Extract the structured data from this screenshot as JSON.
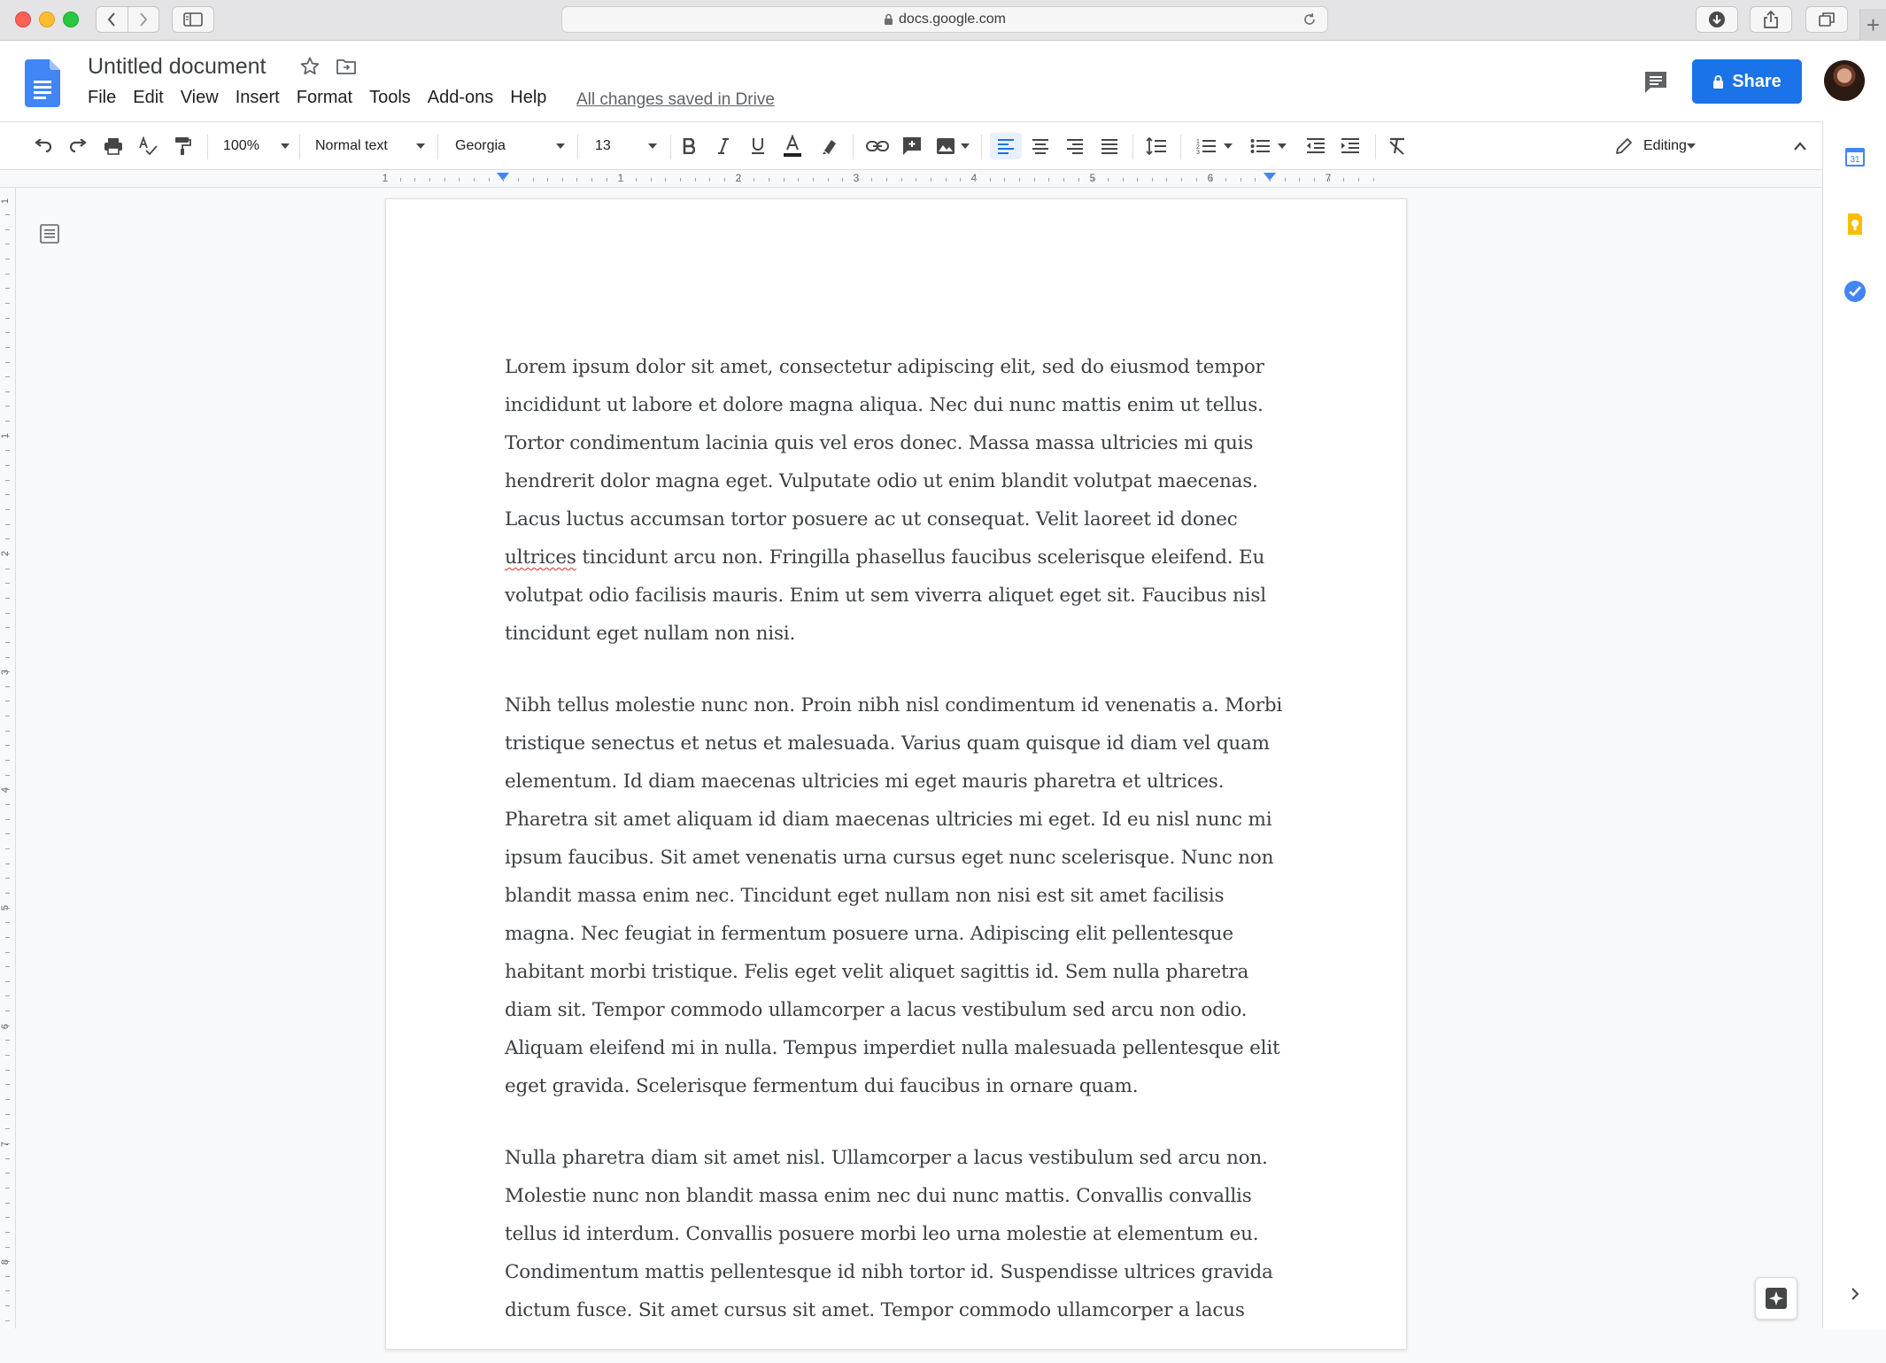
{
  "browser": {
    "url": "docs.google.com"
  },
  "header": {
    "title": "Untitled document",
    "menu": [
      "File",
      "Edit",
      "View",
      "Insert",
      "Format",
      "Tools",
      "Add-ons",
      "Help"
    ],
    "saved_status": "All changes saved in Drive",
    "share_label": "Share"
  },
  "toolbar": {
    "zoom": "100%",
    "style": "Normal text",
    "font": "Georgia",
    "font_size": "13",
    "mode": "Editing"
  },
  "ruler": {
    "labels": [
      "1",
      "1",
      "2",
      "3",
      "4",
      "5",
      "6",
      "7"
    ]
  },
  "v_ruler": {
    "labels": [
      "1",
      "1",
      "2",
      "3",
      "4",
      "5",
      "6",
      "7",
      "8"
    ]
  },
  "document": {
    "p1_before": "Lorem ipsum dolor sit amet, consectetur adipiscing elit, sed do eiusmod tempor incididunt ut labore et dolore magna aliqua. Nec dui nunc mattis enim ut tellus. Tortor condimentum lacinia quis vel eros donec. Massa massa ultricies mi quis hendrerit dolor magna eget. Vulputate odio ut enim blandit volutpat maecenas. Lacus luctus accumsan tortor posuere ac ut consequat. Velit laoreet id donec ",
    "p1_misspelled": "ultrices",
    "p1_after": " tincidunt arcu non. Fringilla phasellus faucibus scelerisque eleifend. Eu volutpat odio facilisis mauris. Enim ut sem viverra aliquet eget sit. Faucibus nisl tincidunt eget nullam non nisi.",
    "p2": "Nibh tellus molestie nunc non. Proin nibh nisl condimentum id venenatis a. Morbi tristique senectus et netus et malesuada. Varius quam quisque id diam vel quam elementum. Id diam maecenas ultricies mi eget mauris pharetra et ultrices. Pharetra sit amet aliquam id diam maecenas ultricies mi eget. Id eu nisl nunc mi ipsum faucibus. Sit amet venenatis urna cursus eget nunc scelerisque. Nunc non blandit massa enim nec. Tincidunt eget nullam non nisi est sit amet facilisis magna. Nec feugiat in fermentum posuere urna. Adipiscing elit pellentesque habitant morbi tristique. Felis eget velit aliquet sagittis id. Sem nulla pharetra diam sit. Tempor commodo ullamcorper a lacus vestibulum sed arcu non odio. Aliquam eleifend mi in nulla. Tempus imperdiet nulla malesuada pellentesque elit eget gravida. Scelerisque fermentum dui faucibus in ornare quam.",
    "p3": "Nulla pharetra diam sit amet nisl. Ullamcorper a lacus vestibulum sed arcu non. Molestie nunc non blandit massa enim nec dui nunc mattis. Convallis convallis tellus id interdum. Convallis posuere morbi leo urna molestie at elementum eu. Condimentum mattis pellentesque id nibh tortor id. Suspendisse ultrices gravida dictum fusce. Sit amet cursus sit amet. Tempor commodo ullamcorper a lacus"
  },
  "side_panel": {
    "calendar_day": "31"
  },
  "icons": {
    "browser": [
      "back-icon",
      "forward-icon",
      "sidebar-icon",
      "lock-icon",
      "reload-icon",
      "download-icon",
      "share-icon",
      "tabs-icon",
      "new-tab-icon"
    ],
    "header": [
      "docs-logo-icon",
      "star-icon",
      "move-folder-icon",
      "comment-icon",
      "lock-icon"
    ],
    "toolbar": [
      "undo-icon",
      "redo-icon",
      "print-icon",
      "spellcheck-icon",
      "paint-format-icon",
      "bold-icon",
      "italic-icon",
      "underline-icon",
      "text-color-icon",
      "highlight-icon",
      "link-icon",
      "add-comment-icon",
      "image-icon",
      "align-left-icon",
      "align-center-icon",
      "align-right-icon",
      "justify-icon",
      "line-spacing-icon",
      "numbered-list-icon",
      "bulleted-list-icon",
      "decrease-indent-icon",
      "increase-indent-icon",
      "clear-formatting-icon",
      "pencil-icon",
      "collapse-icon"
    ],
    "side_panel": [
      "calendar-icon",
      "keep-icon",
      "tasks-icon",
      "expand-panel-icon"
    ]
  },
  "colors": {
    "accent": "#1a73e8",
    "text_color_bar": "#202124",
    "calendar": "#4285f4",
    "keep": "#fbbc04",
    "tasks": "#4285f4"
  }
}
